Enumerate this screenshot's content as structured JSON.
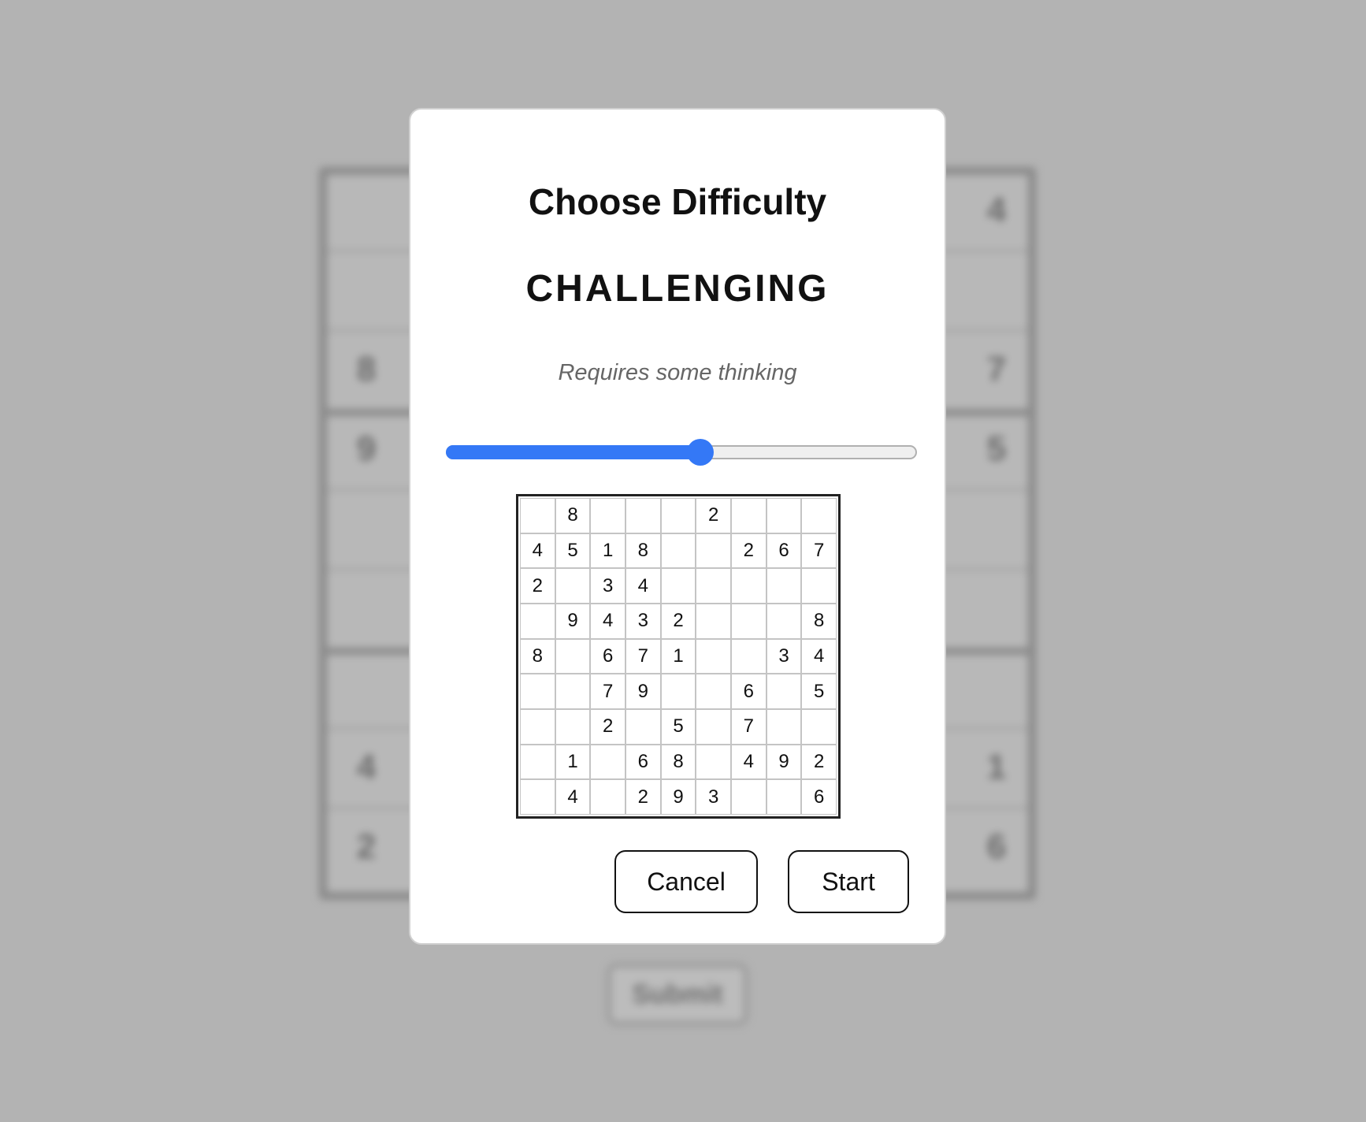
{
  "background": {
    "submit_label": "Submit",
    "digits": [
      {
        "text": "4",
        "side": "right",
        "row": 0
      },
      {
        "text": "8",
        "side": "left",
        "row": 2
      },
      {
        "text": "7",
        "side": "right",
        "row": 2
      },
      {
        "text": "9",
        "side": "left",
        "row": 3
      },
      {
        "text": "5",
        "side": "right",
        "row": 3
      },
      {
        "text": "4",
        "side": "left",
        "row": 7
      },
      {
        "text": "1",
        "side": "right",
        "row": 7
      },
      {
        "text": "2",
        "side": "left",
        "row": 8
      },
      {
        "text": "6",
        "side": "right",
        "row": 8
      }
    ]
  },
  "dialog": {
    "title": "Choose Difficulty",
    "level_name": "CHALLENGING",
    "level_description": "Requires some thinking",
    "slider": {
      "value": 0.54,
      "color": "#3478f6"
    },
    "puzzle": [
      [
        "",
        "8",
        "",
        "",
        "",
        "2",
        "",
        "",
        ""
      ],
      [
        "4",
        "5",
        "1",
        "8",
        "",
        "",
        "2",
        "6",
        "7"
      ],
      [
        "2",
        "",
        "3",
        "4",
        "",
        "",
        "",
        "",
        ""
      ],
      [
        "",
        "9",
        "4",
        "3",
        "2",
        "",
        "",
        "",
        "8"
      ],
      [
        "8",
        "",
        "6",
        "7",
        "1",
        "",
        "",
        "3",
        "4"
      ],
      [
        "",
        "",
        "7",
        "9",
        "",
        "",
        "6",
        "",
        "5"
      ],
      [
        "",
        "",
        "2",
        "",
        "5",
        "",
        "7",
        "",
        ""
      ],
      [
        "",
        "1",
        "",
        "6",
        "8",
        "",
        "4",
        "9",
        "2"
      ],
      [
        "",
        "4",
        "",
        "2",
        "9",
        "3",
        "",
        "",
        "6"
      ]
    ],
    "cancel_label": "Cancel",
    "start_label": "Start"
  }
}
